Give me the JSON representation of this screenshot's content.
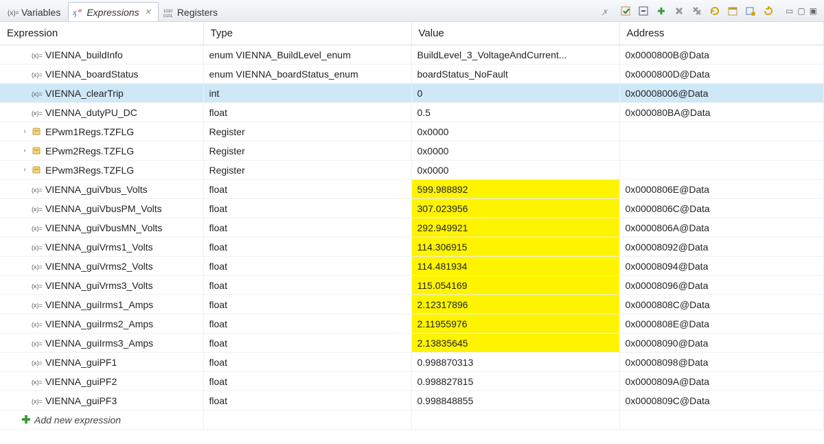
{
  "tabs": {
    "variables": "Variables",
    "expressions": "Expressions",
    "registers": "Registers"
  },
  "columns": {
    "expression": "Expression",
    "type": "Type",
    "value": "Value",
    "address": "Address"
  },
  "rows": [
    {
      "icon": "var",
      "name": "VIENNA_buildInfo",
      "type": "enum VIENNA_BuildLevel_enum",
      "value": "BuildLevel_3_VoltageAndCurrent...",
      "address": "0x0000800B@Data"
    },
    {
      "icon": "var",
      "name": "VIENNA_boardStatus",
      "type": "enum VIENNA_boardStatus_enum",
      "value": "boardStatus_NoFault",
      "address": "0x0000800D@Data"
    },
    {
      "icon": "var",
      "name": "VIENNA_clearTrip",
      "type": "int",
      "value": "0",
      "address": "0x00008006@Data",
      "selected": true
    },
    {
      "icon": "var",
      "name": "VIENNA_dutyPU_DC",
      "type": "float",
      "value": "0.5",
      "address": "0x000080BA@Data"
    },
    {
      "icon": "reg",
      "name": "EPwm1Regs.TZFLG",
      "type": "Register",
      "value": "0x0000",
      "address": "",
      "expandable": true
    },
    {
      "icon": "reg",
      "name": "EPwm2Regs.TZFLG",
      "type": "Register",
      "value": "0x0000",
      "address": "",
      "expandable": true
    },
    {
      "icon": "reg",
      "name": "EPwm3Regs.TZFLG",
      "type": "Register",
      "value": "0x0000",
      "address": "",
      "expandable": true
    },
    {
      "icon": "var",
      "name": "VIENNA_guiVbus_Volts",
      "type": "float",
      "value": "599.988892",
      "address": "0x0000806E@Data",
      "hl": true
    },
    {
      "icon": "var",
      "name": "VIENNA_guiVbusPM_Volts",
      "type": "float",
      "value": "307.023956",
      "address": "0x0000806C@Data",
      "hl": true
    },
    {
      "icon": "var",
      "name": "VIENNA_guiVbusMN_Volts",
      "type": "float",
      "value": "292.949921",
      "address": "0x0000806A@Data",
      "hl": true
    },
    {
      "icon": "var",
      "name": "VIENNA_guiVrms1_Volts",
      "type": "float",
      "value": "114.306915",
      "address": "0x00008092@Data",
      "hl": true
    },
    {
      "icon": "var",
      "name": "VIENNA_guiVrms2_Volts",
      "type": "float",
      "value": "114.481934",
      "address": "0x00008094@Data",
      "hl": true
    },
    {
      "icon": "var",
      "name": "VIENNA_guiVrms3_Volts",
      "type": "float",
      "value": "115.054169",
      "address": "0x00008096@Data",
      "hl": true
    },
    {
      "icon": "var",
      "name": "VIENNA_guiIrms1_Amps",
      "type": "float",
      "value": "2.12317896",
      "address": "0x0000808C@Data",
      "hl": true
    },
    {
      "icon": "var",
      "name": "VIENNA_guiIrms2_Amps",
      "type": "float",
      "value": "2.11955976",
      "address": "0x0000808E@Data",
      "hl": true
    },
    {
      "icon": "var",
      "name": "VIENNA_guiIrms3_Amps",
      "type": "float",
      "value": "2.13835645",
      "address": "0x00008090@Data",
      "hl": true
    },
    {
      "icon": "var",
      "name": "VIENNA_guiPF1",
      "type": "float",
      "value": "0.998870313",
      "address": "0x00008098@Data"
    },
    {
      "icon": "var",
      "name": "VIENNA_guiPF2",
      "type": "float",
      "value": "0.998827815",
      "address": "0x0000809A@Data"
    },
    {
      "icon": "var",
      "name": "VIENNA_guiPF3",
      "type": "float",
      "value": "0.998848855",
      "address": "0x0000809C@Data"
    }
  ],
  "addnew": "Add new expression",
  "colors": {
    "highlight": "#fff400",
    "selection": "#cfe8f8"
  }
}
